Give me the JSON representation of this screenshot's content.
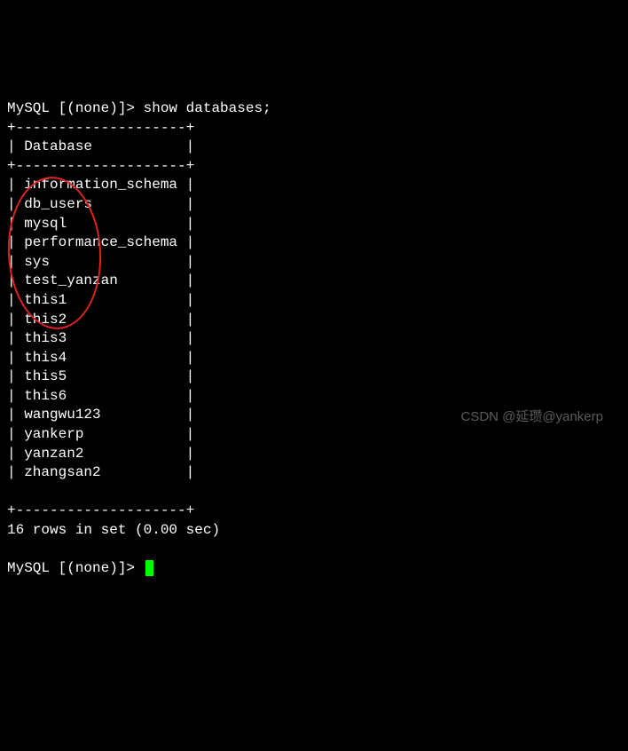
{
  "prompt1": {
    "prefix": "MySQL [(none)]> ",
    "command": "show databases;"
  },
  "table": {
    "border_top": "+--------------------+",
    "header_line": "| Database           |",
    "border_mid": "+--------------------+",
    "rows": [
      "| information_schema |",
      "| db_users           |",
      "| mysql              |",
      "| performance_schema |",
      "| sys                |",
      "| test_yanzan        |",
      "| this1              |",
      "| this2              |",
      "| this3              |",
      "| this4              |",
      "| this5              |",
      "| this6              |",
      "| wangwu123          |",
      "| yankerp            |",
      "| yanzan2            |",
      "| zhangsan2          |"
    ],
    "border_bot": "+--------------------+"
  },
  "result_summary": "16 rows in set (0.00 sec)",
  "prompt2": {
    "prefix": "MySQL [(none)]> "
  },
  "watermark": "CSDN @延瓒@yankerp",
  "annotation": {
    "ellipse_style": "left:9px; top:199px; width:105px; height:172px; transform:rotate(-3deg);"
  }
}
